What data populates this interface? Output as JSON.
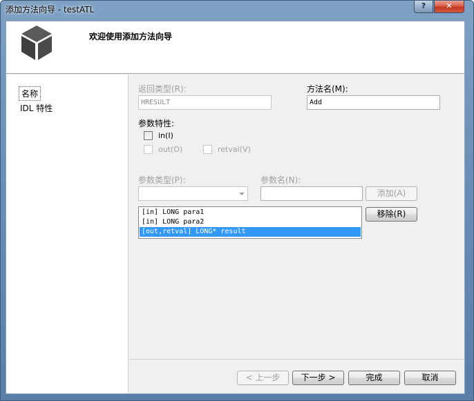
{
  "window": {
    "title": "添加方法向导 - testATL",
    "help_label": "?",
    "close_label": "✕"
  },
  "header": {
    "title": "欢迎使用添加方法向导"
  },
  "sidebar": {
    "items": [
      {
        "label": "名称",
        "selected": true
      },
      {
        "label": "IDL 特性",
        "selected": false
      }
    ]
  },
  "form": {
    "return_type_label": "返回类型(R):",
    "return_type_value": "HRESULT",
    "method_name_label": "方法名(M):",
    "method_name_value": "Add",
    "param_attrs_label": "参数特性:",
    "in_label": "in(I)",
    "out_label": "out(O)",
    "retval_label": "retval(V)",
    "param_type_label": "参数类型(P):",
    "param_type_value": "",
    "param_name_label": "参数名(N):",
    "param_name_value": "",
    "add_button": "添加(A)",
    "remove_button": "移除(R)",
    "params": [
      {
        "text": "[in] LONG para1",
        "selected": false
      },
      {
        "text": "[in] LONG para2",
        "selected": false
      },
      {
        "text": "[out,retval] LONG* result",
        "selected": true
      }
    ]
  },
  "footer": {
    "prev_button": "< 上一步",
    "next_button": "下一步 >",
    "finish_button": "完成",
    "cancel_button": "取消"
  }
}
